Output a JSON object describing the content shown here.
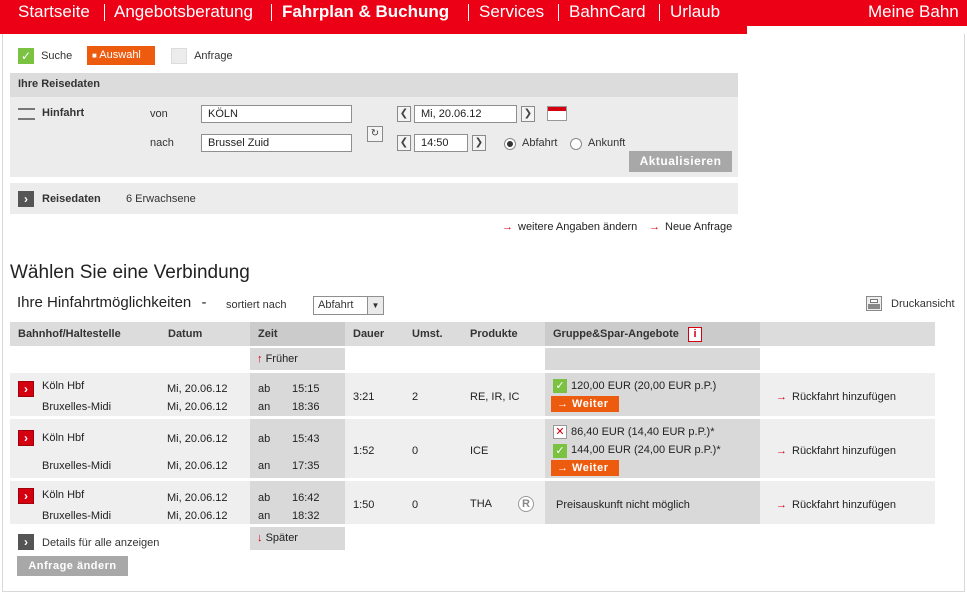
{
  "nav": {
    "items": [
      "Startseite",
      "Angebotsberatung",
      "Fahrplan & Buchung",
      "Services",
      "BahnCard",
      "Urlaub"
    ],
    "right": "Meine Bahn"
  },
  "steps": {
    "suche": "Suche",
    "auswahl": "Auswahl",
    "anfrage": "Anfrage"
  },
  "search": {
    "heading": "Ihre Reisedaten",
    "trip_label": "Hinfahrt",
    "from_label": "von",
    "from_value": "KÖLN",
    "to_label": "nach",
    "to_value": "Brussel Zuid",
    "date_value": "Mi, 20.06.12",
    "time_value": "14:50",
    "depart_label": "Abfahrt",
    "arrive_label": "Ankunft",
    "update_button": "Aktualisieren",
    "travel_data_label": "Reisedaten",
    "travellers": "6 Erwachsene",
    "more_link": "weitere Angaben ändern",
    "new_link": "Neue Anfrage"
  },
  "results": {
    "title": "Wählen Sie eine Verbindung",
    "subtitle": "Ihre Hinfahrtmöglichkeiten",
    "dash": "-",
    "sorted_label": "sortiert nach",
    "sort_value": "Abfahrt",
    "print_label": "Druckansicht",
    "columns": [
      "Bahnhof/Haltestelle",
      "Datum",
      "Zeit",
      "Dauer",
      "Umst.",
      "Produkte",
      "Gruppe&Spar-Angebote"
    ],
    "earlier": "Früher",
    "later": "Später",
    "details_all": "Details für alle anzeigen",
    "change_request": "Anfrage ändern",
    "rows": [
      {
        "from": "Köln Hbf",
        "to": "Bruxelles-Midi",
        "date_from": "Mi, 20.06.12",
        "date_to": "Mi, 20.06.12",
        "ab": "ab",
        "an": "an",
        "dep": "15:15",
        "arr": "18:36",
        "duration": "3:21",
        "changes": "2",
        "products": "RE, IR, IC",
        "offers": [
          {
            "status": "ok",
            "text": "120,00 EUR (20,00 EUR p.P.)"
          }
        ],
        "continue": "→ Weiter",
        "return": "Rückfahrt hinzufügen"
      },
      {
        "from": "Köln Hbf",
        "to": "Bruxelles-Midi",
        "date_from": "Mi, 20.06.12",
        "date_to": "Mi, 20.06.12",
        "ab": "ab",
        "an": "an",
        "dep": "15:43",
        "arr": "17:35",
        "duration": "1:52",
        "changes": "0",
        "products": "ICE",
        "offers": [
          {
            "status": "x",
            "text": "86,40 EUR (14,40 EUR p.P.)*"
          },
          {
            "status": "ok",
            "text": "144,00 EUR (24,00 EUR p.P.)*"
          }
        ],
        "continue": "→ Weiter",
        "return": "Rückfahrt hinzufügen"
      },
      {
        "from": "Köln Hbf",
        "to": "Bruxelles-Midi",
        "date_from": "Mi, 20.06.12",
        "date_to": "Mi, 20.06.12",
        "ab": "ab",
        "an": "an",
        "dep": "16:42",
        "arr": "18:32",
        "duration": "1:50",
        "changes": "0",
        "products": "THA",
        "reservation_badge": "R",
        "price_info": "Preisauskunft nicht möglich",
        "return": "Rückfahrt hinzufügen"
      }
    ]
  },
  "colors": {
    "brand_red": "#ec0016",
    "orange": "#ec5b0e",
    "ok_green": "#7cc242"
  }
}
